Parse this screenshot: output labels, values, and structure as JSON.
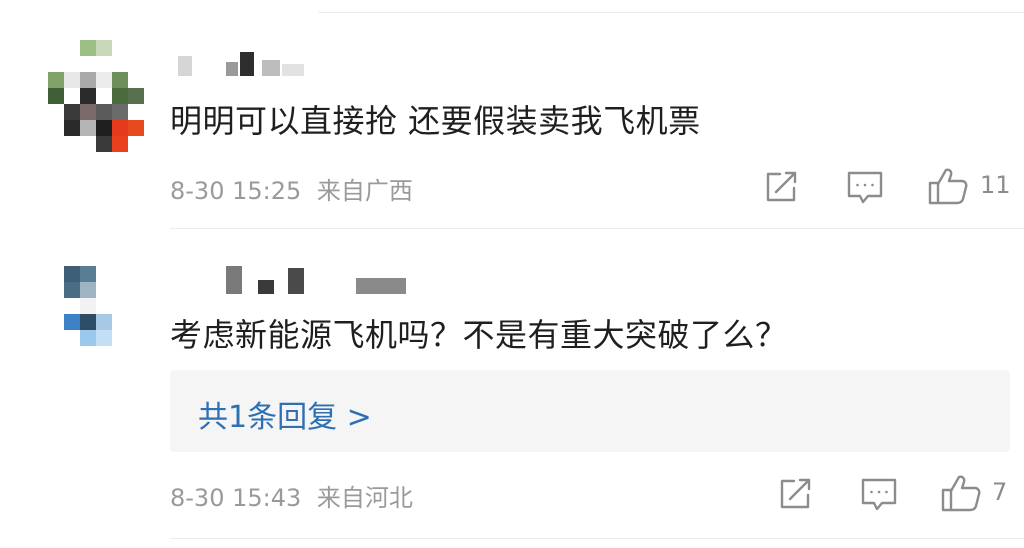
{
  "comments": [
    {
      "text": "明明可以直接抢 还要假装卖我飞机票",
      "time": "8-30 15:25",
      "location": "来自广西",
      "likes": "11"
    },
    {
      "text": "考虑新能源飞机吗？不是有重大突破了么？",
      "time": "8-30 15:43",
      "location": "来自河北",
      "likes": "7",
      "reply_summary": "共1条回复 >"
    }
  ],
  "icons": {
    "share": "share-icon",
    "comment": "comment-icon",
    "like": "thumbs-up-icon"
  },
  "colors": {
    "text": "#1f1f1f",
    "meta": "#9a9a9a",
    "link": "#2f6fb3",
    "reply_bg": "#f5f5f5"
  }
}
